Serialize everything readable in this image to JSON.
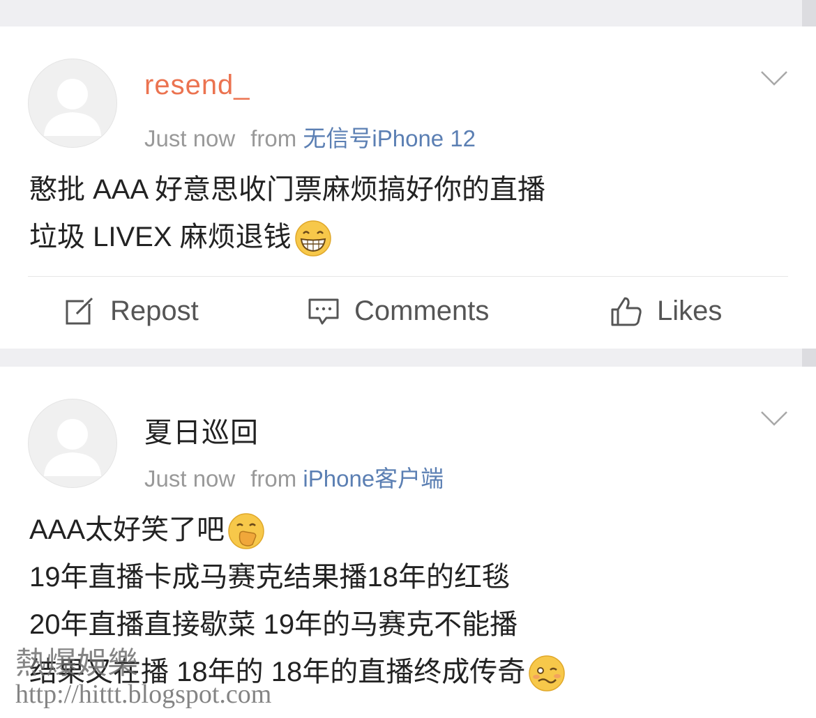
{
  "posts": [
    {
      "username": "resend_",
      "time": "Just now",
      "from_label": "from",
      "source": "无信号iPhone 12",
      "lines": [
        "憨批 AAA 好意思收门票麻烦搞好你的直播",
        "垃圾 LIVEX 麻烦退钱"
      ],
      "emoji": "grinning-face-with-smiling-eyes-emoji"
    },
    {
      "username": "夏日巡回",
      "time": "Just now",
      "from_label": "from",
      "source": "iPhone客户端",
      "lines": [
        "AAA太好笑了吧",
        "19年直播卡成马赛克结果播18年的红毯",
        "20年直播直接歇菜 19年的马赛克不能播",
        "结果又在播 18年的 18年的直播终成传奇"
      ],
      "emojis": [
        "face-with-hand-over-mouth-emoji",
        "woozy-face-emoji"
      ]
    }
  ],
  "actions": {
    "repost": "Repost",
    "comments": "Comments",
    "likes": "Likes"
  },
  "watermark": {
    "line1": "熱爆娛樂",
    "line2": "http://hittt.blogspot.com"
  },
  "colors": {
    "username_orange": "#eb7350",
    "source_link": "#5b7fb3",
    "meta_gray": "#999999",
    "separator": "#efeff2"
  }
}
